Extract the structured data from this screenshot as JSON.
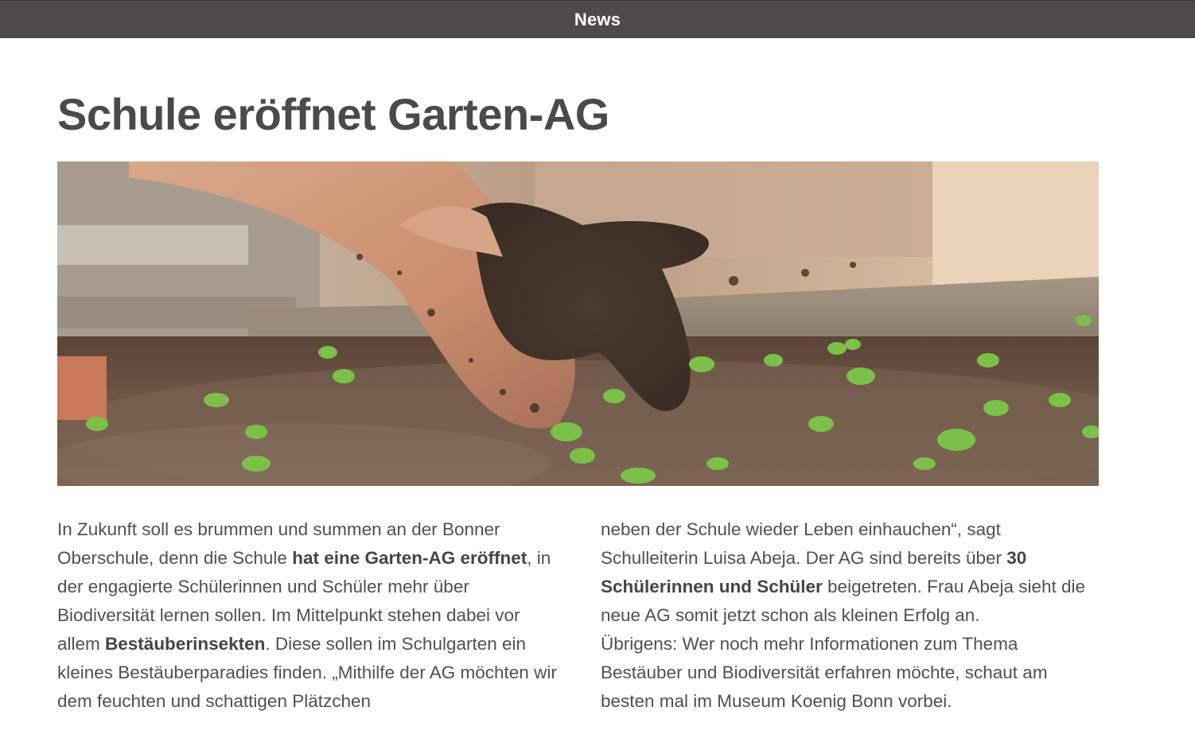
{
  "topbar": {
    "title": "News"
  },
  "article": {
    "headline": "Schule eröffnet Garten-AG",
    "image": {
      "icon": "garden-hands-photo"
    },
    "column_left": {
      "s1": "In Zukunft soll es brummen und summen an der Bonner Oberschule, denn die Schule ",
      "b1": "hat eine Garten-AG eröffnet",
      "s2": ", in der engagierte Schülerinnen und Schüler mehr über Biodiversität lernen sollen. Im Mittelpunkt stehen dabei vor allem ",
      "b2": "Bestäuberinsekten",
      "s3": ". Diese sollen im Schulgarten ein kleines Bestäuberparadies finden. „Mithilfe der AG möchten wir dem feuchten und schattigen Plätzchen"
    },
    "column_right": {
      "s1": "neben der Schule wieder Leben einhauchen“, sagt Schulleiterin Luisa Abeja. Der AG sind bereits über ",
      "b1": "30 Schülerinnen und Schüler",
      "s2": " beigetreten. Frau Abeja sieht die neue AG somit jetzt schon als kleinen Erfolg an.",
      "p2": "Übrigens: Wer noch mehr Informationen zum Thema Bestäuber und Biodiversität erfahren möchte, schaut am besten mal im Museum Koenig Bonn vorbei."
    }
  },
  "colors": {
    "topbar": "#4d4b49",
    "text": "#4a4a4a",
    "soil": "#6b5444",
    "sprout": "#7cc04a"
  }
}
